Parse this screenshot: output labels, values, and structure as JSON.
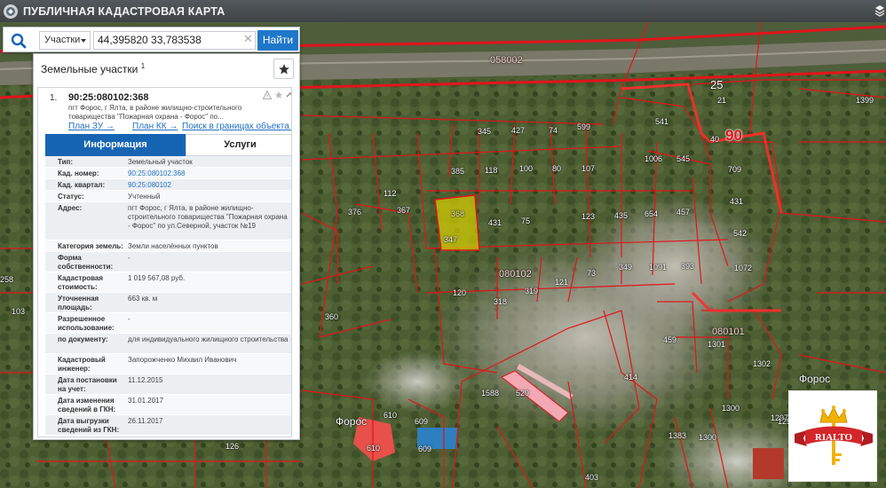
{
  "app": {
    "title": "ПУБЛИЧНАЯ КАДАСТРОВАЯ КАРТА"
  },
  "search": {
    "type_label": "Участки",
    "query": "44,395820 33,783538",
    "button_label": "Найти"
  },
  "panel": {
    "title": "Земельные участки",
    "title_count": "1",
    "item": {
      "index": "1.",
      "cad_number": "90:25:080102:368",
      "address_short": "пгт Форос, г Ялта, в районе жилищно-строительного товарищества \"Пожарная охрана - Форос\" по...",
      "links": {
        "plan_zu": "План ЗУ →",
        "plan_kk": "План КК →",
        "search_object": "Поиск в границах объекта →"
      },
      "tabs": {
        "info": "Информация",
        "services": "Услуги"
      },
      "rows": [
        {
          "k": "Тип:",
          "v": "Земельный участок"
        },
        {
          "k": "Кад. номер:",
          "v": "90:25:080102:368",
          "link": true
        },
        {
          "k": "Кад. квартал:",
          "v": "90:25:080102",
          "link": true
        },
        {
          "k": "Статус:",
          "v": "Учтенный"
        },
        {
          "k": "Адрес:",
          "v": "пгт Форос, г Ялта, в районе жилищно-строительного товарищества \"Пожарная охрана - Форос\" по ул.Северной, участок №19"
        },
        {
          "k": "Категория земель:",
          "v": "Земли населённых пунктов"
        },
        {
          "k": "Форма собственности:",
          "v": "-"
        },
        {
          "k": "Кадастровая стоимость:",
          "v": "1 019 567,08 руб."
        },
        {
          "k": "Уточненная площадь:",
          "v": "663 кв. м"
        },
        {
          "k": "Разрешенное использование:",
          "v": "-"
        },
        {
          "k": "по документу:",
          "v": "для индивидуального жилищного строительства"
        },
        {
          "k": "Кадастровый инженер:",
          "v": "Запорожченко Михаил Иванович"
        },
        {
          "k": "Дата постановки на учет:",
          "v": "11.12.2015"
        },
        {
          "k": "Дата изменения сведений в ГКН:",
          "v": "31.01.2017"
        },
        {
          "k": "Дата выгрузки сведений из ГКН:",
          "v": "26.11.2017"
        }
      ]
    }
  },
  "map": {
    "quarters": [
      "058002",
      "080102",
      "080101",
      "25"
    ],
    "big_numbers": [
      "90"
    ],
    "places": [
      "Форос",
      "Форос"
    ],
    "parcels": [
      "1399",
      "541",
      "21",
      "40",
      "545",
      "709",
      "431",
      "542",
      "1072",
      "599",
      "74",
      "427",
      "345",
      "1006",
      "385",
      "118",
      "100",
      "80",
      "107",
      "123",
      "435",
      "654",
      "457",
      "368",
      "431",
      "75",
      "347",
      "080102",
      "349",
      "1091",
      "393",
      "73",
      "121",
      "319",
      "318",
      "120",
      "459",
      "1301",
      "1302",
      "414",
      "1300",
      "1297",
      "1588",
      "529",
      "1383",
      "1300",
      "126",
      "403",
      "610",
      "609",
      "609",
      "376",
      "112",
      "367",
      "360",
      "258",
      "103",
      "1296",
      "610"
    ],
    "brand": "RIALTO"
  },
  "colors": {
    "accent": "#1665b3",
    "boundary": "#e3141b",
    "selected": "#e8e000"
  }
}
